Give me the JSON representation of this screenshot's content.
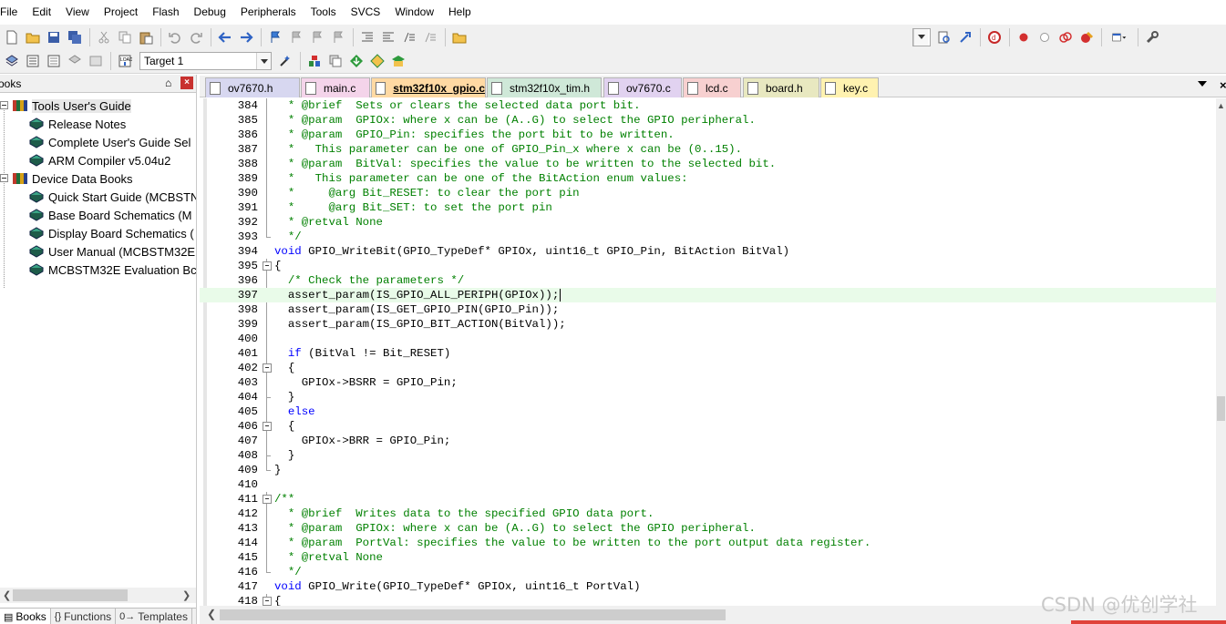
{
  "menu": [
    "File",
    "Edit",
    "View",
    "Project",
    "Flash",
    "Debug",
    "Peripherals",
    "Tools",
    "SVCS",
    "Window",
    "Help"
  ],
  "toolbar2": {
    "target_label": "Target 1"
  },
  "left_panel": {
    "title": "ooks",
    "pin_glyph": "⌂",
    "close_glyph": "×",
    "tree": [
      {
        "label": "Tools User's Guide",
        "level": 0
      },
      {
        "label": "Release Notes",
        "level": 1
      },
      {
        "label": "Complete User's Guide Sel",
        "level": 1
      },
      {
        "label": "ARM Compiler v5.04u2",
        "level": 1
      },
      {
        "label": "Device Data Books",
        "level": 0
      },
      {
        "label": "Quick Start Guide (MCBSTN",
        "level": 1
      },
      {
        "label": "Base Board Schematics (M",
        "level": 1
      },
      {
        "label": "Display Board Schematics (",
        "level": 1
      },
      {
        "label": "User Manual (MCBSTM32E",
        "level": 1
      },
      {
        "label": "MCBSTM32E Evaluation Bc",
        "level": 1
      }
    ],
    "tabs": [
      {
        "label": "Books",
        "icon": "▤"
      },
      {
        "label": "Functions",
        "icon": "{}"
      },
      {
        "label": "Templates",
        "icon": "0→"
      }
    ]
  },
  "editor_tabs": [
    {
      "label": "ov7670.h",
      "color": "#d7d7f0"
    },
    {
      "label": "main.c",
      "color": "#f4d4ea"
    },
    {
      "label": "stm32f10x_gpio.c",
      "color": "#ffd9a3",
      "active": true
    },
    {
      "label": "stm32f10x_tim.h",
      "color": "#cfe8d8"
    },
    {
      "label": "ov7670.c",
      "color": "#e1d2f0"
    },
    {
      "label": "lcd.c",
      "color": "#f7d0d0"
    },
    {
      "label": "board.h",
      "color": "#e8e8c0"
    },
    {
      "label": "key.c",
      "color": "#fff2b0"
    }
  ],
  "code_lines": [
    {
      "n": "384",
      "t": "  * @brief  Sets or clears the selected data port bit."
    },
    {
      "n": "385",
      "t": "  * @param  GPIOx: where x can be (A..G) to select the GPIO peripheral."
    },
    {
      "n": "386",
      "t": "  * @param  GPIO_Pin: specifies the port bit to be written."
    },
    {
      "n": "387",
      "t": "  *   This parameter can be one of GPIO_Pin_x where x can be (0..15)."
    },
    {
      "n": "388",
      "t": "  * @param  BitVal: specifies the value to be written to the selected bit."
    },
    {
      "n": "389",
      "t": "  *   This parameter can be one of the BitAction enum values:"
    },
    {
      "n": "390",
      "t": "  *     @arg Bit_RESET: to clear the port pin"
    },
    {
      "n": "391",
      "t": "  *     @arg Bit_SET: to set the port pin"
    },
    {
      "n": "392",
      "t": "  * @retval None"
    },
    {
      "n": "393",
      "t": "  */"
    },
    {
      "n": "394",
      "t": "void GPIO_WriteBit(GPIO_TypeDef* GPIOx, uint16_t GPIO_Pin, BitAction BitVal)"
    },
    {
      "n": "395",
      "t": "{"
    },
    {
      "n": "396",
      "t": "  /* Check the parameters */"
    },
    {
      "n": "397",
      "t": "  assert_param(IS_GPIO_ALL_PERIPH(GPIOx));"
    },
    {
      "n": "398",
      "t": "  assert_param(IS_GET_GPIO_PIN(GPIO_Pin));"
    },
    {
      "n": "399",
      "t": "  assert_param(IS_GPIO_BIT_ACTION(BitVal));"
    },
    {
      "n": "400",
      "t": ""
    },
    {
      "n": "401",
      "t": "  if (BitVal != Bit_RESET)"
    },
    {
      "n": "402",
      "t": "  {"
    },
    {
      "n": "403",
      "t": "    GPIOx->BSRR = GPIO_Pin;"
    },
    {
      "n": "404",
      "t": "  }"
    },
    {
      "n": "405",
      "t": "  else"
    },
    {
      "n": "406",
      "t": "  {"
    },
    {
      "n": "407",
      "t": "    GPIOx->BRR = GPIO_Pin;"
    },
    {
      "n": "408",
      "t": "  }"
    },
    {
      "n": "409",
      "t": "}"
    },
    {
      "n": "410",
      "t": ""
    },
    {
      "n": "411",
      "t": "/**"
    },
    {
      "n": "412",
      "t": "  * @brief  Writes data to the specified GPIO data port."
    },
    {
      "n": "413",
      "t": "  * @param  GPIOx: where x can be (A..G) to select the GPIO peripheral."
    },
    {
      "n": "414",
      "t": "  * @param  PortVal: specifies the value to be written to the port output data register."
    },
    {
      "n": "415",
      "t": "  * @retval None"
    },
    {
      "n": "416",
      "t": "  */"
    },
    {
      "n": "417",
      "t": "void GPIO_Write(GPIO_TypeDef* GPIOx, uint16_t PortVal)"
    },
    {
      "n": "418",
      "t": "{"
    }
  ],
  "cursor_line": "397",
  "watermark": "CSDN @优创学社",
  "colors": {
    "comment": "#008000",
    "keyword": "#0000ff",
    "current_line": "#e9fbe9",
    "active_tab": "#ffd9a3"
  }
}
